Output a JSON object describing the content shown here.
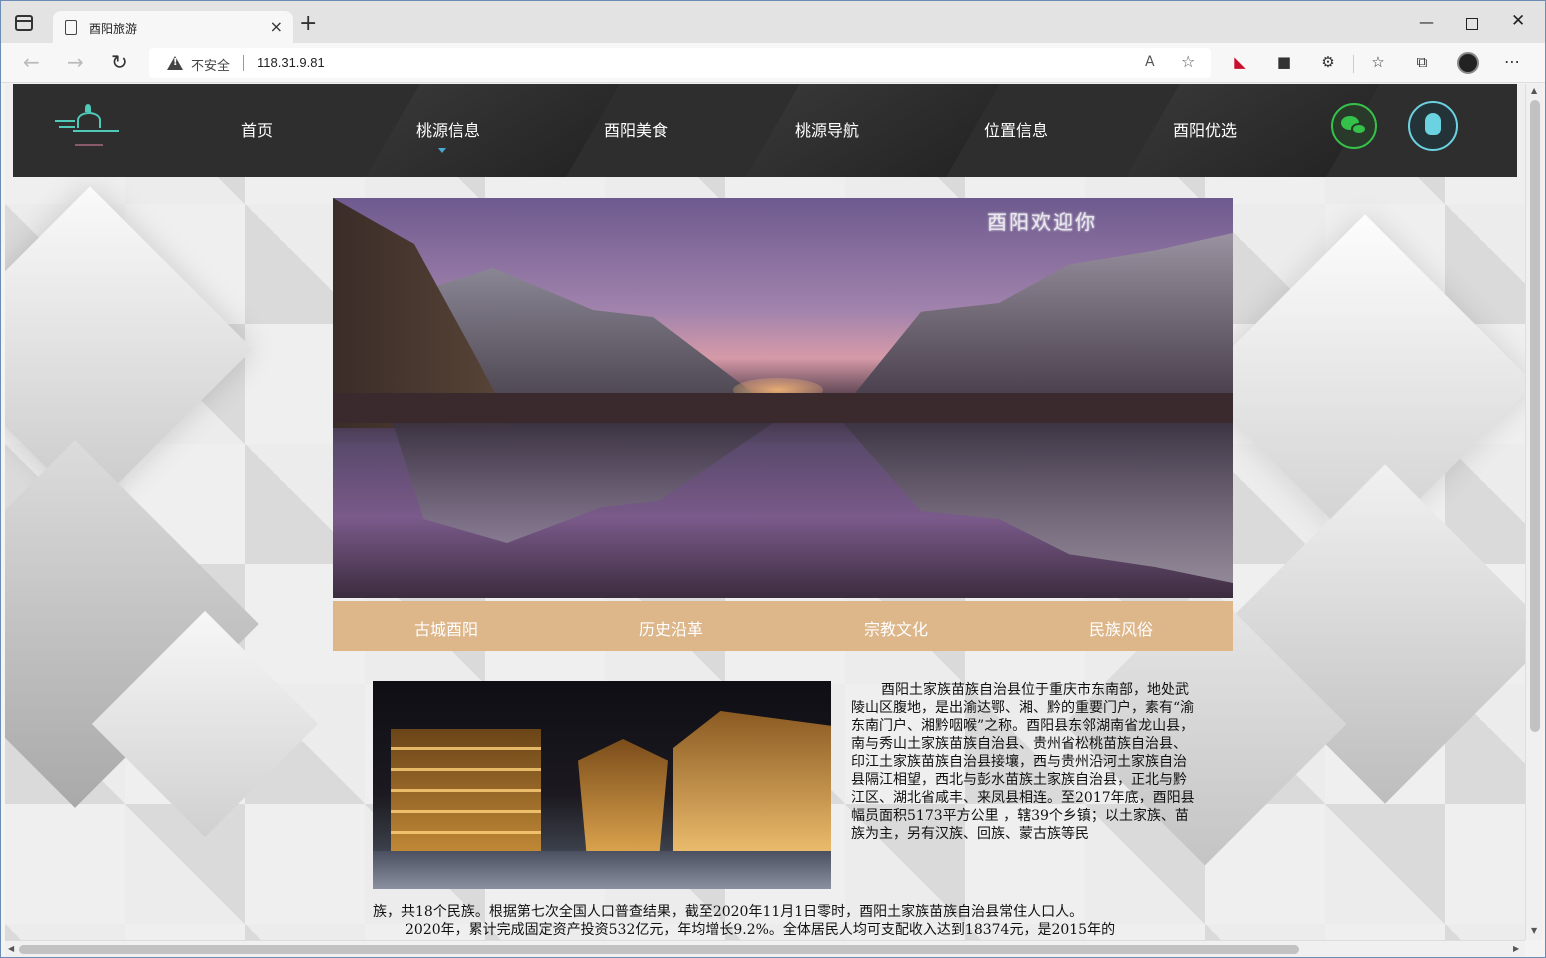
{
  "browser": {
    "tab_title": "酉阳旅游",
    "tab_close": "×",
    "new_tab": "+",
    "security_label": "不安全",
    "url": "118.31.9.81",
    "window_min": "—",
    "window_close": "✕"
  },
  "site": {
    "nav_items": [
      "首页",
      "桃源信息",
      "酉阳美食",
      "桃源导航",
      "位置信息",
      "酉阳优选"
    ],
    "active_nav": "桃源信息",
    "hero_title": "酉阳欢迎你",
    "subnav_items": [
      "古城酉阳",
      "历史沿革",
      "宗教文化",
      "民族风俗"
    ],
    "paragraph_1": "酉阳土家族苗族自治县位于重庆市东南部，地处武陵山区腹地，是出渝达鄂、湘、黔的重要门户，素有“渝东南门户、湘黔咽喉”之称。酉阳县东邻湖南省龙山县，南与秀山土家族苗族自治县、贵州省松桃苗族自治县、印江土家族苗族自治县接壤，西与贵州沿河土家族自治县隔江相望，西北与彭水苗族土家族自治县，正北与黔江区、湖北省咸丰、来凤县相连。至2017年底，酉阳县幅员面积5173平方公里 ，辖39个乡镇；以土家族、苗族为主，另有汉族、回族、蒙古族等民",
    "paragraph_2": "族，共18个民族。根据第七次全国人口普查结果，截至2020年11月1日零时，酉阳土家族苗族自治县常住人口人。",
    "paragraph_3": "2020年，累计完成固定资产投资532亿元，年均增长9.2%。全体居民人均可支配收入达到18374元，是2015年的"
  },
  "colors": {
    "nav_bg": "#2e2e2e",
    "subnav_bg": "#ddb68a",
    "accent_caret": "#4aa8d8",
    "wechat_green": "#35c24a",
    "qq_cyan": "#6ad2e0"
  },
  "icons": {
    "wechat": "wechat-icon",
    "qq": "qq-icon",
    "logo": "site-logo"
  }
}
